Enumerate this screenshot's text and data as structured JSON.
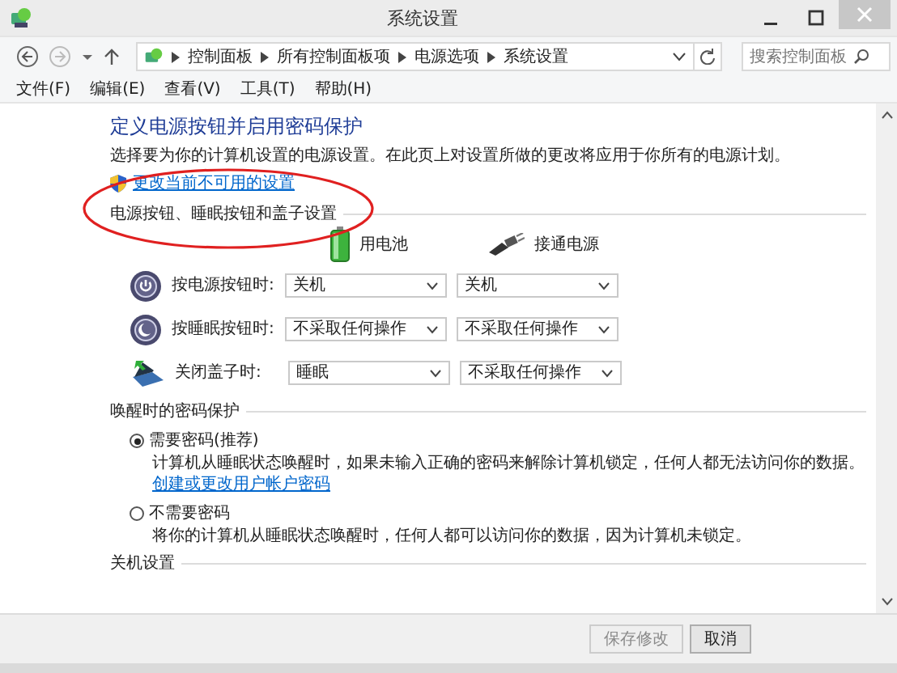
{
  "window": {
    "title": "系统设置"
  },
  "nav": {
    "breadcrumbs": [
      "控制面板",
      "所有控制面板项",
      "电源选项",
      "系统设置"
    ],
    "search": {
      "placeholder": "搜索控制面板"
    }
  },
  "menu": [
    "文件(F)",
    "编辑(E)",
    "查看(V)",
    "工具(T)",
    "帮助(H)"
  ],
  "page": {
    "heading": "定义电源按钮并启用密码保护",
    "description": "选择要为你的计算机设置的电源设置。在此页上对设置所做的更改将应用于你所有的电源计划。",
    "link": "更改当前不可用的设置",
    "sections": [
      {
        "kind": "buttons",
        "title": "电源按钮、睡眠按钮和盖子设置",
        "columns": [
          {
            "kind": "battery",
            "label": "用电池"
          },
          {
            "kind": "plug",
            "label": "接通电源"
          }
        ],
        "rows": [
          {
            "kind": "power",
            "label": "按电源按钮时:",
            "values": [
              "关机",
              "关机"
            ]
          },
          {
            "kind": "sleep",
            "label": "按睡眠按钮时:",
            "values": [
              "不采取任何操作",
              "不采取任何操作"
            ]
          },
          {
            "kind": "lid",
            "label": "关闭盖子时:",
            "values": [
              "睡眠",
              "不采取任何操作"
            ]
          }
        ]
      },
      {
        "kind": "options",
        "title": "唤醒时的密码保护",
        "options": [
          {
            "label": "需要密码(推荐)",
            "selected": true,
            "description": "计算机从睡眠状态唤醒时，如果未输入正确的密码来解除计算机锁定，任何人都无法访问你的数据。",
            "link": "创建或更改用户帐户密码"
          },
          {
            "label": "不需要密码",
            "selected": false,
            "description": "将你的计算机从睡眠状态唤醒时，任何人都可以访问你的数据，因为计算机未锁定。"
          }
        ]
      },
      {
        "kind": "heading",
        "title": "关机设置"
      }
    ]
  },
  "buttons": [
    {
      "label": "保存修改",
      "disabled": true
    },
    {
      "label": "取消",
      "disabled": false
    }
  ],
  "annotations": [
    {
      "kind": "ellipse",
      "color": "#e02020"
    }
  ]
}
